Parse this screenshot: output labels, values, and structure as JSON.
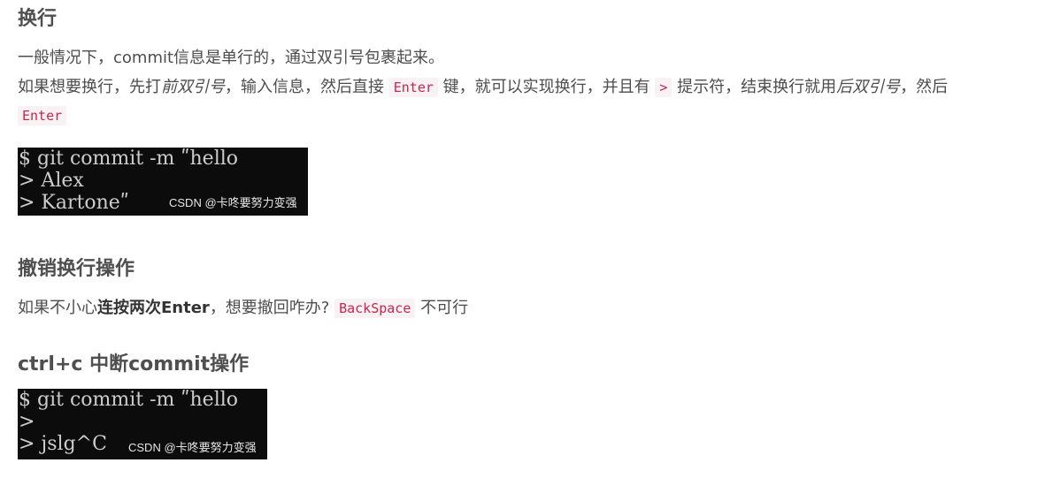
{
  "section1": {
    "title": "换行",
    "line1": "一般情况下，commit信息是单行的，通过双引号包裹起来。",
    "line2": {
      "t1": "如果想要换行，先打",
      "em1": "前双引号",
      "t2": "，输入信息，然后直接 ",
      "code1": "Enter",
      "t3": " 键，就可以实现换行，并且有 ",
      "code2": ">",
      "t4": " 提示符，结束换行就用",
      "em2": "后双引号",
      "t5": "，然后",
      "code3": "Enter"
    },
    "terminal": {
      "lines": [
        "$ git commit -m ʺhello",
        "> Alex",
        "> Kartoneʺ"
      ],
      "watermark": "CSDN @卡咚要努力变强"
    }
  },
  "section2": {
    "title": "撤销换行操作",
    "t1": "如果不小心",
    "strong1": "连按两次Enter",
    "t2": "，想要撤回咋办? ",
    "code1": "BackSpace",
    "t3": " 不可行"
  },
  "section3": {
    "title": "ctrl+c 中断commit操作",
    "terminal": {
      "lines": [
        "$ git commit -m ʺhello",
        ">",
        "> jslg^C"
      ],
      "watermark": "CSDN @卡咚要努力变强"
    }
  }
}
